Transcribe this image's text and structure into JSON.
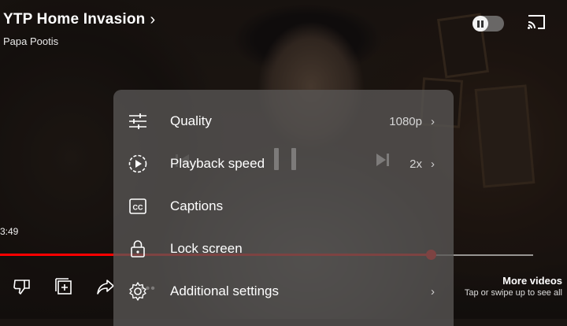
{
  "video": {
    "title": "YTP Home Invasion",
    "channel": "Papa Pootis",
    "current_time": "3:49",
    "progress_fraction": 0.76,
    "buffered_fraction": 0.94
  },
  "more_videos": {
    "title": "More videos",
    "subtitle": "Tap or swipe up to see all"
  },
  "settings_menu": {
    "items": [
      {
        "label": "Quality",
        "value": "1080p",
        "icon": "sliders-icon",
        "has_chevron": true
      },
      {
        "label": "Playback speed",
        "value": "2x",
        "icon": "playback-speed-icon",
        "has_chevron": true
      },
      {
        "label": "Captions",
        "value": "",
        "icon": "captions-icon",
        "has_chevron": false
      },
      {
        "label": "Lock screen",
        "value": "",
        "icon": "lock-icon",
        "has_chevron": false
      },
      {
        "label": "Additional settings",
        "value": "",
        "icon": "gear-icon",
        "has_chevron": true
      }
    ]
  },
  "colors": {
    "progress_played": "#ff0000",
    "sheet_background": "rgba(88,86,84,0.78)"
  },
  "icons": {
    "autoplay": "autoplay-toggle-icon",
    "cast": "cast-icon",
    "prev": "previous-icon",
    "pause": "pause-icon",
    "next": "next-icon",
    "dislike": "dislike-icon",
    "save": "save-to-playlist-icon",
    "share": "share-icon",
    "more": "more-icon"
  }
}
